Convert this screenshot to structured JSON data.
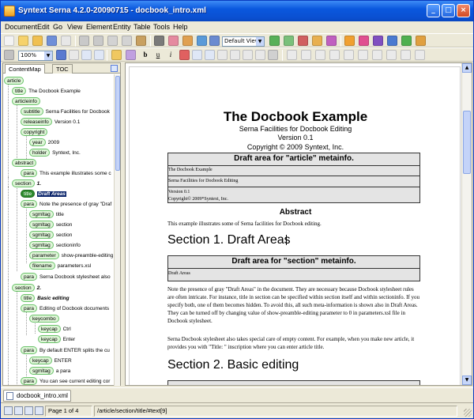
{
  "window": {
    "title": "Syntext Serna 4.2.0-20090715 - docbook_intro.xml"
  },
  "menu": [
    "Document",
    "Edit",
    "Go",
    "View",
    "Element",
    "Entity",
    "Table",
    "Tools",
    "Help"
  ],
  "toolbar": {
    "view_select": "Default View",
    "zoom_select": "100%",
    "format": {
      "bold": "b",
      "underline": "u",
      "italic": "i"
    }
  },
  "tabs": [
    "ContentMap",
    "TOC"
  ],
  "tree": [
    {
      "tag": "article",
      "text": ""
    },
    {
      "tag": "title",
      "text": "The Docbook Example"
    },
    {
      "tag": "articleinfo",
      "text": ""
    },
    {
      "tag": "subtitle",
      "text": "Serna Facilities for Docbook"
    },
    {
      "tag": "releaseinfo",
      "text": "Version 0.1"
    },
    {
      "tag": "copyright",
      "text": ""
    },
    {
      "tag": "year",
      "text": "2009"
    },
    {
      "tag": "holder",
      "text": "Syntext, Inc."
    },
    {
      "tag": "abstract",
      "text": ""
    },
    {
      "tag": "para",
      "text": "This example illustrates some c"
    },
    {
      "tag": "section",
      "text": "1."
    },
    {
      "tag": "title",
      "text": "Draft Areas"
    },
    {
      "tag": "para",
      "text": "Note the presence of gray \"Draf"
    },
    {
      "tag": "sgmltag",
      "text": "title"
    },
    {
      "tag": "sgmltag",
      "text": "section"
    },
    {
      "tag": "sgmltag",
      "text": "section"
    },
    {
      "tag": "sgmltag",
      "text": "sectioninfo"
    },
    {
      "tag": "parameter",
      "text": "show-preamble-editing"
    },
    {
      "tag": "filename",
      "text": "parameters.xsl"
    },
    {
      "tag": "para",
      "text": "Serna Docbook stylesheet also"
    },
    {
      "tag": "section",
      "text": "2."
    },
    {
      "tag": "title",
      "text": "Basic editing"
    },
    {
      "tag": "para",
      "text": "Editing of Docbook documents"
    },
    {
      "tag": "keycombo",
      "text": ""
    },
    {
      "tag": "keycap",
      "text": "Ctrl"
    },
    {
      "tag": "keycap",
      "text": "Enter"
    },
    {
      "tag": "para",
      "text": "By default ENTER splits the cu"
    },
    {
      "tag": "keycap",
      "text": "ENTER"
    },
    {
      "tag": "sgmltag",
      "text": "a para"
    },
    {
      "tag": "para",
      "text": "You can see current editing cor"
    }
  ],
  "document": {
    "title": "The Docbook Example",
    "subtitle": "Serna Facilities for Docbook Editing",
    "version": "Version 0.1",
    "copyright": "Copyright © 2009 Syntext, Inc.",
    "draft_article": {
      "header": "Draft area for \"article\" metainfo.",
      "lines": [
        "The Docbook Example",
        "Serna Facilities for Docbook Editing",
        "Version 0.1",
        "Copyright© 2009*Syntext, Inc."
      ]
    },
    "abstract_heading": "Abstract",
    "abstract_para": "This example illustrates some of Serna facilities for Docbook editing.",
    "section1_heading": "Section 1. Draft Areas",
    "draft_section": {
      "header": "Draft area for \"section\" metainfo.",
      "line": "Draft Areas"
    },
    "section1_para1": "Note the presence of gray \"Draft Areas\" in the document. They are necessary because Docbook stylesheet rules are often intricate. For instance, title in section can be specified within section itself and within sectioninfo. If you specify both, one of them becomes hidden. To avoid this, all such meta-information is shown also in Draft Areas. They can be turned off by changing value of show-preamble-editing parameter to 0 in parameters.xsl file in Docbook stylesheet.",
    "section1_para2": "Serna Docbook stylesheet also takes special care of empty content. For example, when you make new article, it provides you with \"Title: \" inscription where you can enter article title.",
    "section2_heading": "Section 2. Basic editing"
  },
  "doc_tab": "docbook_intro.xml",
  "status": {
    "page": "Page 1 of 4",
    "path": "/article/section/title/#text[9]"
  }
}
